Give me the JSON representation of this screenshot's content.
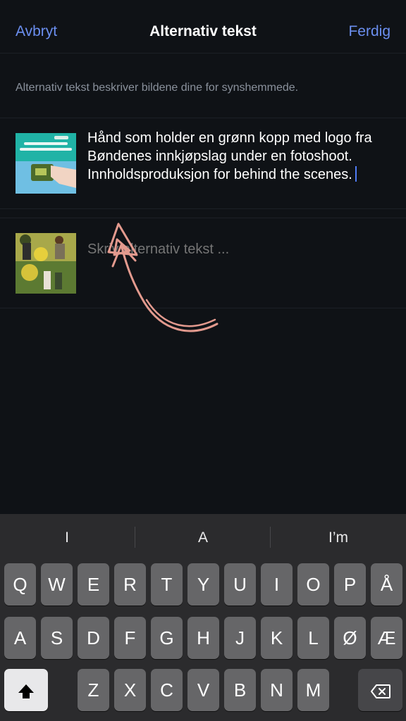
{
  "header": {
    "cancel_label": "Avbryt",
    "title": "Alternativ tekst",
    "done_label": "Ferdig"
  },
  "hint": "Alternativ tekst beskriver bildene dine for synshemmede.",
  "images": [
    {
      "thumbnail_icon": "fotoshoot-thumbnail-image",
      "alt_text": "Hånd som holder en grønn kopp med logo fra Bøndenes innkjøpslag under en fotoshoot. Innholdsproduksjon for behind the scenes."
    },
    {
      "thumbnail_icon": "outdoor-people-thumbnail-image",
      "placeholder": "Skriv alternativ tekst ..."
    }
  ],
  "annotation_icon": "hand-drawn-arrow-icon",
  "colors": {
    "accent": "#6b8ff0",
    "background": "#0f1216",
    "arrow": "#e39a8e",
    "keyboard": "#2b2b2d"
  },
  "keyboard": {
    "suggestions": [
      "I",
      "A",
      "I’m"
    ],
    "row1": [
      "Q",
      "W",
      "E",
      "R",
      "T",
      "Y",
      "U",
      "I",
      "O",
      "P",
      "Å"
    ],
    "row2": [
      "A",
      "S",
      "D",
      "F",
      "G",
      "H",
      "J",
      "K",
      "L",
      "Ø",
      "Æ"
    ],
    "row3": [
      "Z",
      "X",
      "C",
      "V",
      "B",
      "N",
      "M"
    ],
    "shift_icon": "shift-icon",
    "backspace_icon": "backspace-icon"
  }
}
